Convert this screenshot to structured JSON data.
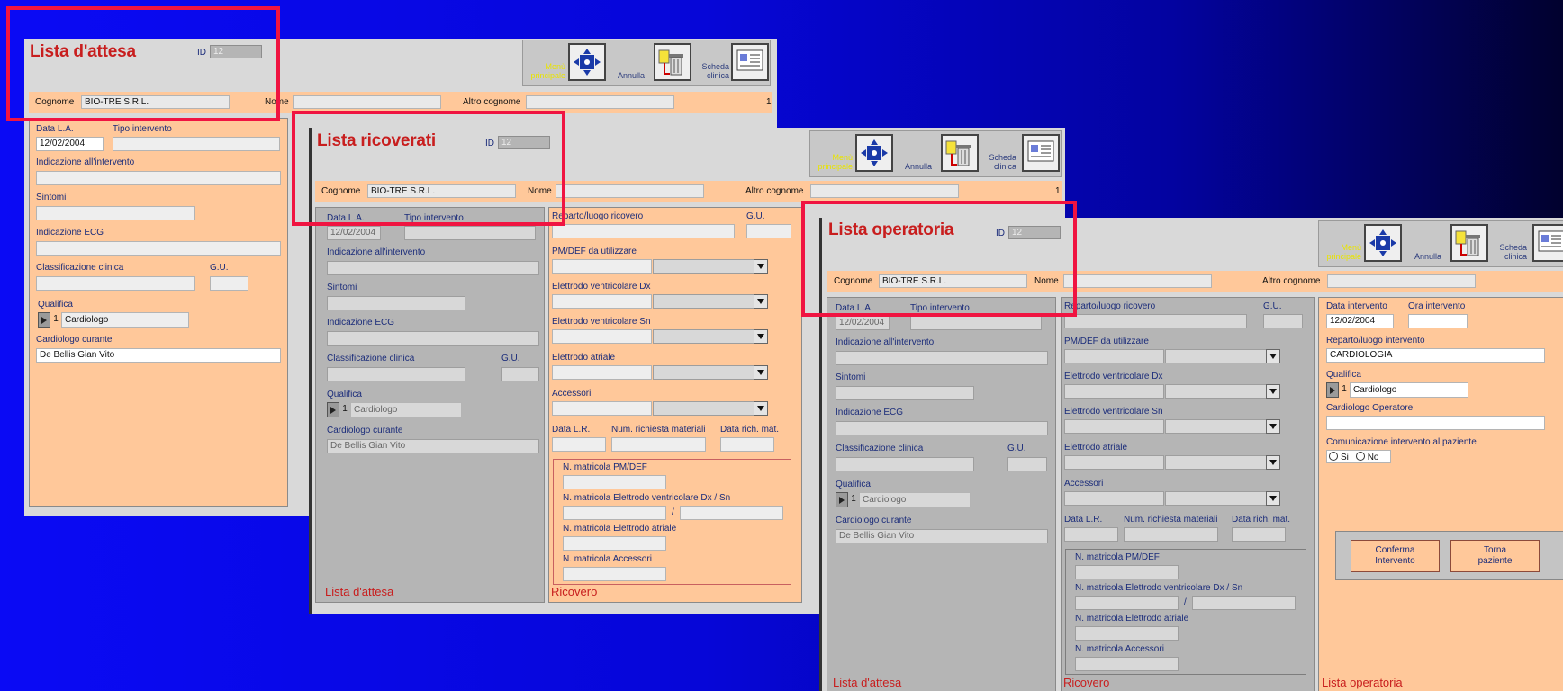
{
  "colors": {
    "title": "#c81e1e",
    "label": "#1b2c7a",
    "peach": "#ffc89a",
    "highlight": "#f01441",
    "yellow_label": "#e9e400"
  },
  "common": {
    "id_label": "ID",
    "id_value": "12",
    "cognome_label": "Cognome",
    "cognome_value": "BIO-TRE S.R.L.",
    "nome_label": "Nome",
    "altro_cognome_label": "Altro cognome",
    "record_count": "1",
    "menu_label_1": "Menù",
    "menu_label_2": "principale",
    "annulla_label": "Annulla",
    "scheda_label_1": "Scheda",
    "scheda_label_2": "clinica",
    "icons": {
      "menu": "crosshair-arrows-icon",
      "annulla": "trash-bin-icon",
      "scheda": "clinical-card-icon"
    }
  },
  "attesa_fields": {
    "data_la_label": "Data L.A.",
    "data_la_value": "12/02/2004",
    "tipo_intervento_label": "Tipo intervento",
    "indicazione_label": "Indicazione all'intervento",
    "sintomi_label": "Sintomi",
    "ecg_label": "Indicazione ECG",
    "classificazione_label": "Classificazione clinica",
    "gu_label": "G.U.",
    "qualifica_label": "Qualifica",
    "qualifica_num": "1",
    "qualifica_value": "Cardiologo",
    "curante_label": "Cardiologo curante",
    "curante_value": "De Bellis  Gian Vito",
    "curante_value_alt": "De Bellis  Gian Vito",
    "footer": "Lista d'attesa"
  },
  "ricovero_fields": {
    "reparto_label": "Reparto/luogo ricovero",
    "gu_label": "G.U.",
    "pmdef_label": "PM/DEF da utilizzare",
    "vdx_label": "Elettrodo ventricolare Dx",
    "vsn_label": "Elettrodo ventricolare Sn",
    "atriale_label": "Elettrodo atriale",
    "accessori_label": "Accessori",
    "data_lr_label": "Data L.R.",
    "num_richiesta_label": "Num. richiesta materiali",
    "data_rich_label": "Data rich. mat.",
    "matricola_pmdef_label": "N. matricola PM/DEF",
    "matricola_vent_label": "N. matricola Elettrodo ventricolare Dx / Sn",
    "slash": "/",
    "matricola_atriale_label": "N. matricola Elettrodo atriale",
    "matricola_accessori_label": "N. matricola Accessori",
    "footer": "Ricovero"
  },
  "window1": {
    "title": "Lista d'attesa"
  },
  "window2": {
    "title": "Lista ricoverati"
  },
  "window3": {
    "title": "Lista operatoria",
    "data_intervento_label": "Data intervento",
    "data_intervento_value": "12/02/2004",
    "ora_intervento_label": "Ora intervento",
    "reparto_intervento_label": "Reparto/luogo intervento",
    "reparto_intervento_value": "CARDIOLOGIA",
    "qualifica_label": "Qualifica",
    "qualifica_num": "1",
    "qualifica_value": "Cardiologo",
    "operatore_label": "Cardiologo Operatore",
    "comunicazione_label": "Comunicazione intervento al paziente",
    "si_label": "Si",
    "no_label": "No",
    "conferma_label_1": "Conferma",
    "conferma_label_2": "Intervento",
    "torna_label_1": "Torna",
    "torna_label_2": "paziente",
    "footer_op": "Lista operatoria"
  }
}
